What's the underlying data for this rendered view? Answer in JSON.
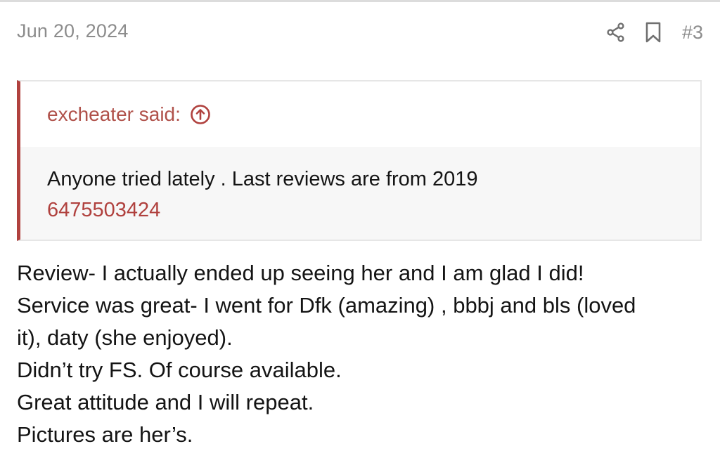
{
  "post": {
    "date": "Jun 20, 2024",
    "number": "#3",
    "icons": {
      "share": "share-icon",
      "bookmark": "bookmark-icon"
    }
  },
  "quote": {
    "author_label": "excheater said:",
    "jump_icon": "arrow-up-circle-icon",
    "lines": [
      "Anyone tried lately . Last reviews are from 2019"
    ],
    "phone": "6475503424"
  },
  "body": {
    "lines": [
      "Review- I actually ended up seeing her and I am glad I did!",
      "Service was great- I went for Dfk (amazing) , bbbj and bls (loved",
      "it), daty (she enjoyed).",
      "Didn’t try FS. Of course available.",
      "Great attitude and I will repeat.",
      "Pictures are her’s."
    ]
  },
  "colors": {
    "accent": "#b0413e",
    "muted_text": "#8c8c8c",
    "quote_bg": "#f7f7f7"
  }
}
